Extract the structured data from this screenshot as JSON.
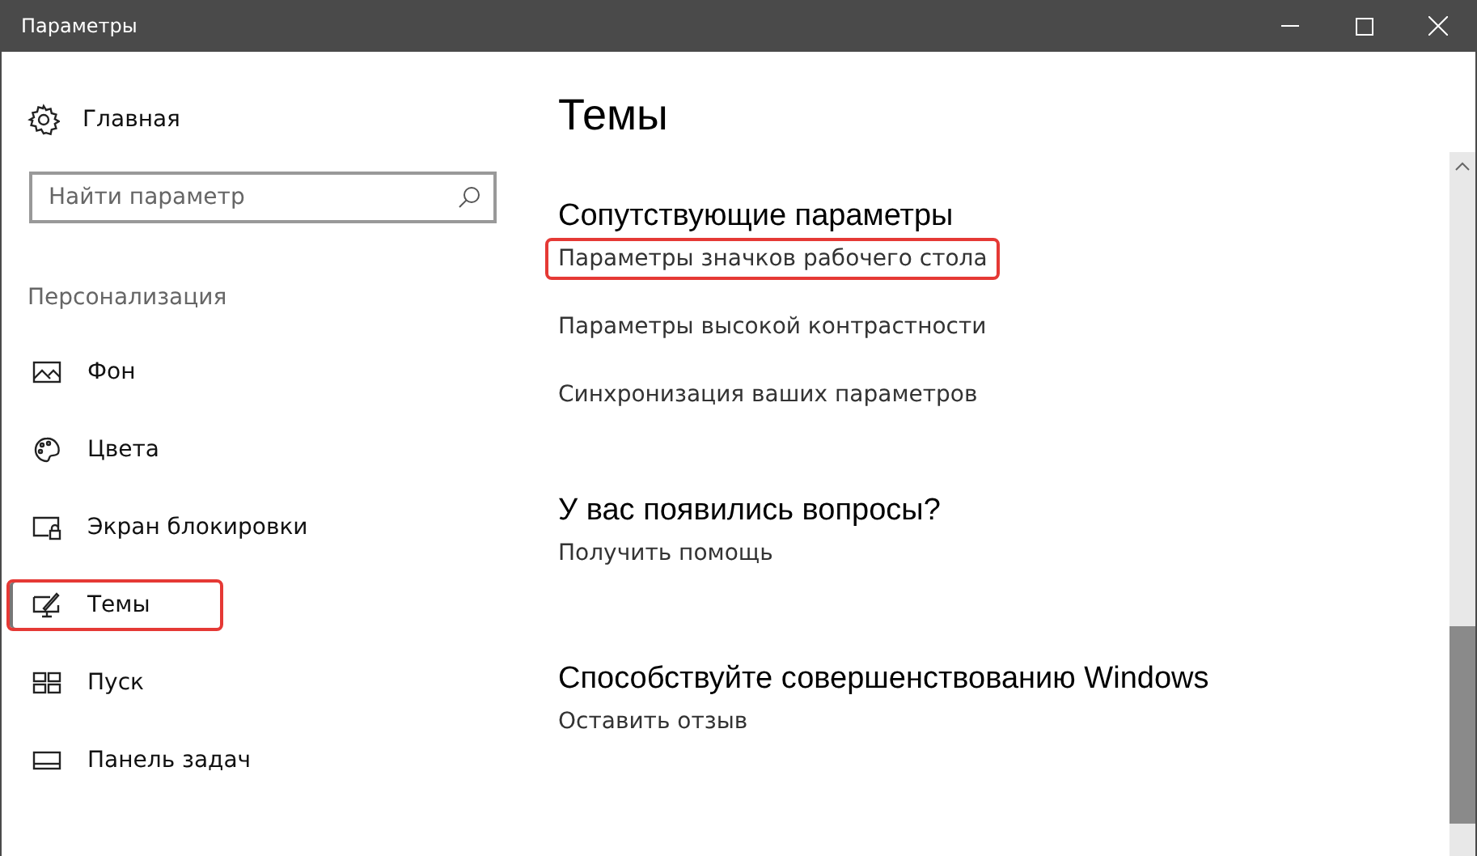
{
  "window": {
    "title": "Параметры"
  },
  "sidebar": {
    "home": "Главная",
    "search": {
      "placeholder": "Найти параметр"
    },
    "section": "Персонализация",
    "items": [
      {
        "label": "Фон",
        "kind": "image",
        "selected": false,
        "highlighted": false
      },
      {
        "label": "Цвета",
        "kind": "palette",
        "selected": false,
        "highlighted": false
      },
      {
        "label": "Экран блокировки",
        "kind": "lock",
        "selected": false,
        "highlighted": false
      },
      {
        "label": "Темы",
        "kind": "theme",
        "selected": true,
        "highlighted": true
      },
      {
        "label": "Пуск",
        "kind": "start",
        "selected": false,
        "highlighted": false
      },
      {
        "label": "Панель задач",
        "kind": "taskbar",
        "selected": false,
        "highlighted": false
      }
    ]
  },
  "content": {
    "title": "Темы",
    "sections": [
      {
        "heading": "Сопутствующие параметры",
        "links": [
          {
            "label": "Параметры значков рабочего стола",
            "highlighted": true
          },
          {
            "label": "Параметры высокой контрастности",
            "highlighted": false
          },
          {
            "label": "Синхронизация ваших параметров",
            "highlighted": false
          }
        ]
      },
      {
        "heading": "У вас появились вопросы?",
        "links": [
          {
            "label": "Получить помощь",
            "highlighted": false
          }
        ]
      },
      {
        "heading": "Способствуйте совершенствованию Windows",
        "links": [
          {
            "label": "Оставить отзыв",
            "highlighted": false
          }
        ]
      }
    ]
  }
}
